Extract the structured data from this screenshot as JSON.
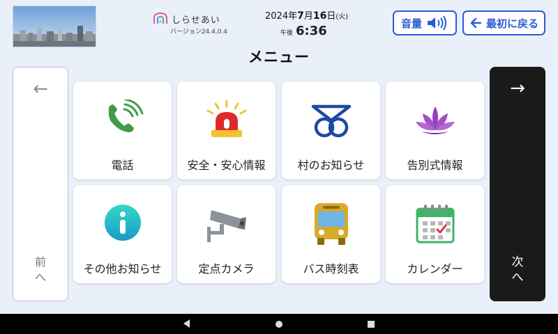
{
  "header": {
    "photo_icon": "city-skyline-photo",
    "logo_text": "しらせあい",
    "version": "バージョン24.4.0.4",
    "date": {
      "year": "2024年",
      "month": "7",
      "month_suffix": "月",
      "day": "16",
      "day_suffix": "日",
      "weekday": "(火)"
    },
    "time": {
      "ampm": "午後",
      "clock": "6:36"
    },
    "volume_button": {
      "label": "音量",
      "icon": "speaker-icon"
    },
    "back_button": {
      "label": "最初に戻る",
      "icon": "arrow-left-icon"
    }
  },
  "page_title": "メニュー",
  "prev_panel": {
    "arrow": "←",
    "label": "前",
    "chevron": "へ"
  },
  "next_panel": {
    "arrow": "→",
    "label": "次",
    "chevron": "へ"
  },
  "menu": [
    {
      "label": "電話",
      "icon": "phone-icon"
    },
    {
      "label": "安全・安心情報",
      "icon": "alarm-light-icon"
    },
    {
      "label": "村のお知らせ",
      "icon": "village-emblem-icon"
    },
    {
      "label": "告別式情報",
      "icon": "lotus-icon"
    },
    {
      "label": "その他お知らせ",
      "icon": "info-icon"
    },
    {
      "label": "定点カメラ",
      "icon": "security-camera-icon"
    },
    {
      "label": "バス時刻表",
      "icon": "bus-icon"
    },
    {
      "label": "カレンダー",
      "icon": "calendar-icon"
    }
  ],
  "colors": {
    "accent": "#2a5bd7",
    "background": "#e9f0fa",
    "next_panel": "#1a1a1a"
  }
}
